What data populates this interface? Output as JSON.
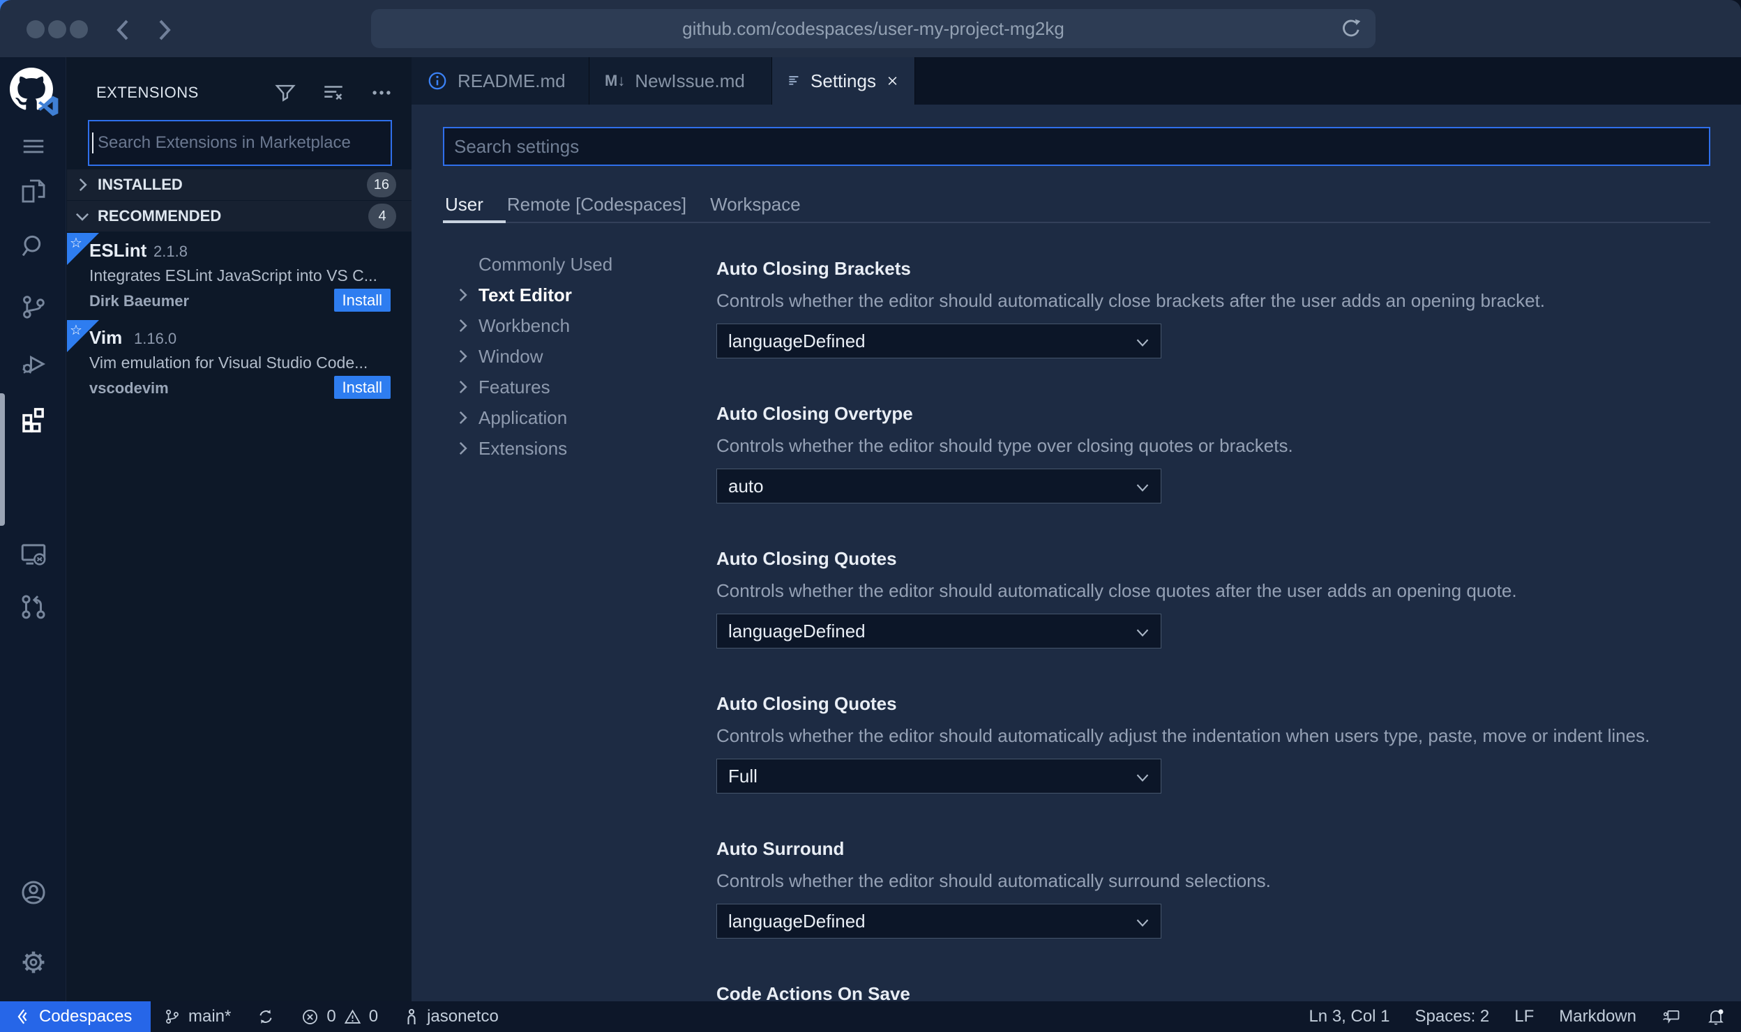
{
  "browser": {
    "url": "github.com/codespaces/user-my-project-mg2kg"
  },
  "icons": {
    "markdown_glyph": "M↓",
    "star_glyph": "☆"
  },
  "sidebar": {
    "title": "EXTENSIONS",
    "search_placeholder": "Search Extensions in Marketplace",
    "sections": [
      {
        "label": "INSTALLED",
        "count": "16"
      },
      {
        "label": "RECOMMENDED",
        "count": "4"
      }
    ],
    "extensions": [
      {
        "name": "ESLint",
        "version": "2.1.8",
        "description": "Integrates ESLint JavaScript into VS C...",
        "publisher": "Dirk Baeumer",
        "action": "Install"
      },
      {
        "name": "Vim",
        "version": "1.16.0",
        "description": "Vim emulation for Visual Studio Code...",
        "publisher": "vscodevim",
        "action": "Install"
      }
    ]
  },
  "tabs": [
    {
      "label": "README.md"
    },
    {
      "label": "NewIssue.md"
    },
    {
      "label": "Settings"
    }
  ],
  "settings": {
    "search_placeholder": "Search settings",
    "scopes": [
      "User",
      "Remote [Codespaces]",
      "Workspace"
    ],
    "toc": [
      "Commonly Used",
      "Text Editor",
      "Workbench",
      "Window",
      "Features",
      "Application",
      "Extensions"
    ],
    "items": [
      {
        "title": "Auto Closing Brackets",
        "description": "Controls whether the editor should automatically close brackets after the user adds an opening bracket.",
        "value": "languageDefined"
      },
      {
        "title": "Auto Closing Overtype",
        "description": "Controls whether the editor should type over closing quotes or brackets.",
        "value": "auto"
      },
      {
        "title": "Auto Closing Quotes",
        "description": "Controls whether the editor should automatically close quotes after the user adds an opening quote.",
        "value": "languageDefined"
      },
      {
        "title": "Auto Closing Quotes",
        "description": "Controls whether the editor should automatically adjust the indentation when users type, paste, move or indent lines.",
        "value": "Full"
      },
      {
        "title": "Auto Surround",
        "description": "Controls whether the editor should automatically surround selections.",
        "value": "languageDefined"
      },
      {
        "title": "Code Actions On Save"
      }
    ]
  },
  "status_bar": {
    "codespaces": "Codespaces",
    "branch": "main*",
    "errors": "0",
    "warnings": "0",
    "user": "jasonetco",
    "cursor": "Ln 3, Col 1",
    "indent": "Spaces: 2",
    "eol": "LF",
    "language": "Markdown"
  },
  "colors": {
    "accent_blue": "#2e7df0",
    "focus_border": "#2f6feb",
    "codespaces_blue": "#2666e8"
  }
}
